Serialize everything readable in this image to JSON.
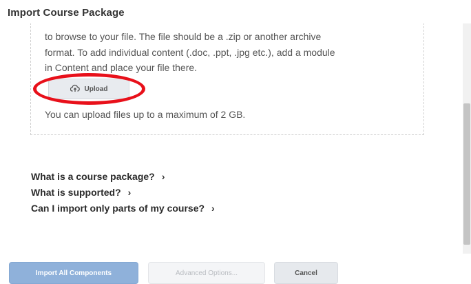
{
  "dialog": {
    "title": "Import Course Package"
  },
  "dropzone": {
    "lines": [
      "to browse to your file. The file should be a .zip or another archive",
      "format. To add individual content (.doc, .ppt, .jpg etc.), add a module",
      "in Content and place your file there."
    ],
    "upload_label": "Upload",
    "upload_icon": "cloud-upload-icon",
    "limit_text": "You can upload files up to a maximum of 2 GB."
  },
  "help_links": [
    {
      "label": "What is a course package?",
      "icon": "chevron-right-icon"
    },
    {
      "label": "What is supported?",
      "icon": "chevron-right-icon"
    },
    {
      "label": "Can I import only parts of my course?",
      "icon": "chevron-right-icon"
    }
  ],
  "footer": {
    "import_label": "Import All Components",
    "advanced_label": "Advanced Options...",
    "cancel_label": "Cancel"
  },
  "colors": {
    "highlight_ring": "#e8101a",
    "primary_button": "#8fb1da"
  }
}
